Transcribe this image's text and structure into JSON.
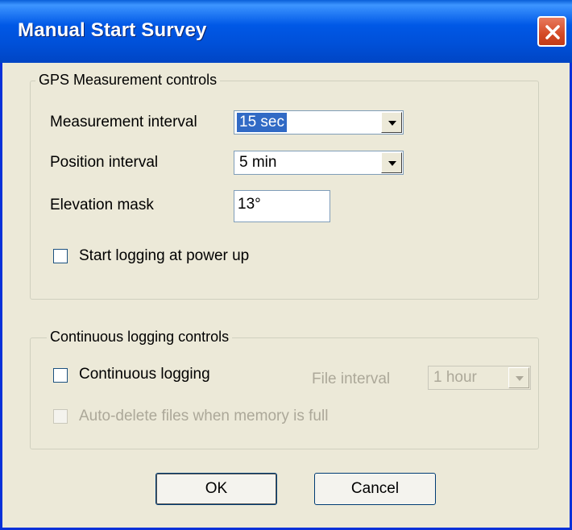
{
  "window": {
    "title": "Manual Start Survey"
  },
  "gps_group": {
    "title": "GPS Measurement controls",
    "measurement_interval": {
      "label": "Measurement interval",
      "value": "15 sec"
    },
    "position_interval": {
      "label": "Position interval",
      "value": "5 min"
    },
    "elevation_mask": {
      "label": "Elevation mask",
      "value": "13°"
    },
    "start_logging": {
      "label": "Start logging at power up",
      "checked": false
    }
  },
  "continuous_group": {
    "title": "Continuous logging controls",
    "continuous_logging": {
      "label": "Continuous logging",
      "checked": false
    },
    "file_interval": {
      "label": "File interval",
      "value": "1 hour"
    },
    "auto_delete": {
      "label": "Auto-delete files when memory is full",
      "checked": false
    }
  },
  "buttons": {
    "ok": "OK",
    "cancel": "Cancel"
  },
  "colors": {
    "titlebar": "#0058e6",
    "selection": "#316ac5",
    "background": "#ece9d8"
  }
}
